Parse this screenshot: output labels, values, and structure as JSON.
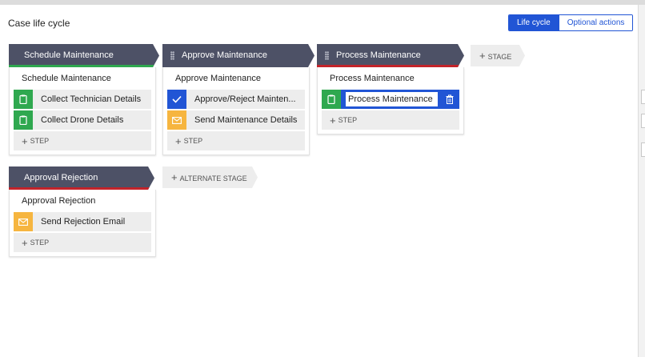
{
  "header": {
    "title": "Case life cycle"
  },
  "toggle": {
    "lifecycle": "Life cycle",
    "optional": "Optional actions"
  },
  "stages": [
    {
      "name": "Schedule Maintenance",
      "process": "Schedule Maintenance",
      "steps": [
        {
          "label": "Collect Technician Details",
          "icon": "clipboard-icon"
        },
        {
          "label": "Collect Drone Details",
          "icon": "clipboard-icon"
        }
      ],
      "add_step": "STEP"
    },
    {
      "name": "Approve Maintenance",
      "process": "Approve Maintenance",
      "steps": [
        {
          "label": "Approve/Reject Mainten...",
          "icon": "checkmark-icon"
        },
        {
          "label": "Send Maintenance Details",
          "icon": "envelope-icon"
        }
      ],
      "add_step": "STEP"
    },
    {
      "name": "Process Maintenance",
      "process": "Process Maintenance",
      "steps": [
        {
          "label": "Process Maintenance",
          "icon": "clipboard-icon"
        }
      ],
      "add_step": "STEP"
    }
  ],
  "alternate_stages": [
    {
      "name": "Approval Rejection",
      "process": "Approval Rejection",
      "steps": [
        {
          "label": "Send Rejection Email",
          "icon": "envelope-icon"
        }
      ],
      "add_step": "STEP"
    }
  ],
  "add_stage_label": "STAGE",
  "add_alternate_stage_label": "ALTERNATE STAGE",
  "colors": {
    "header_bg": "#4d5166",
    "accent_blue": "#2155d5",
    "green": "#2fa84f",
    "amber": "#f6b53f",
    "red_line": "#c3232a"
  }
}
